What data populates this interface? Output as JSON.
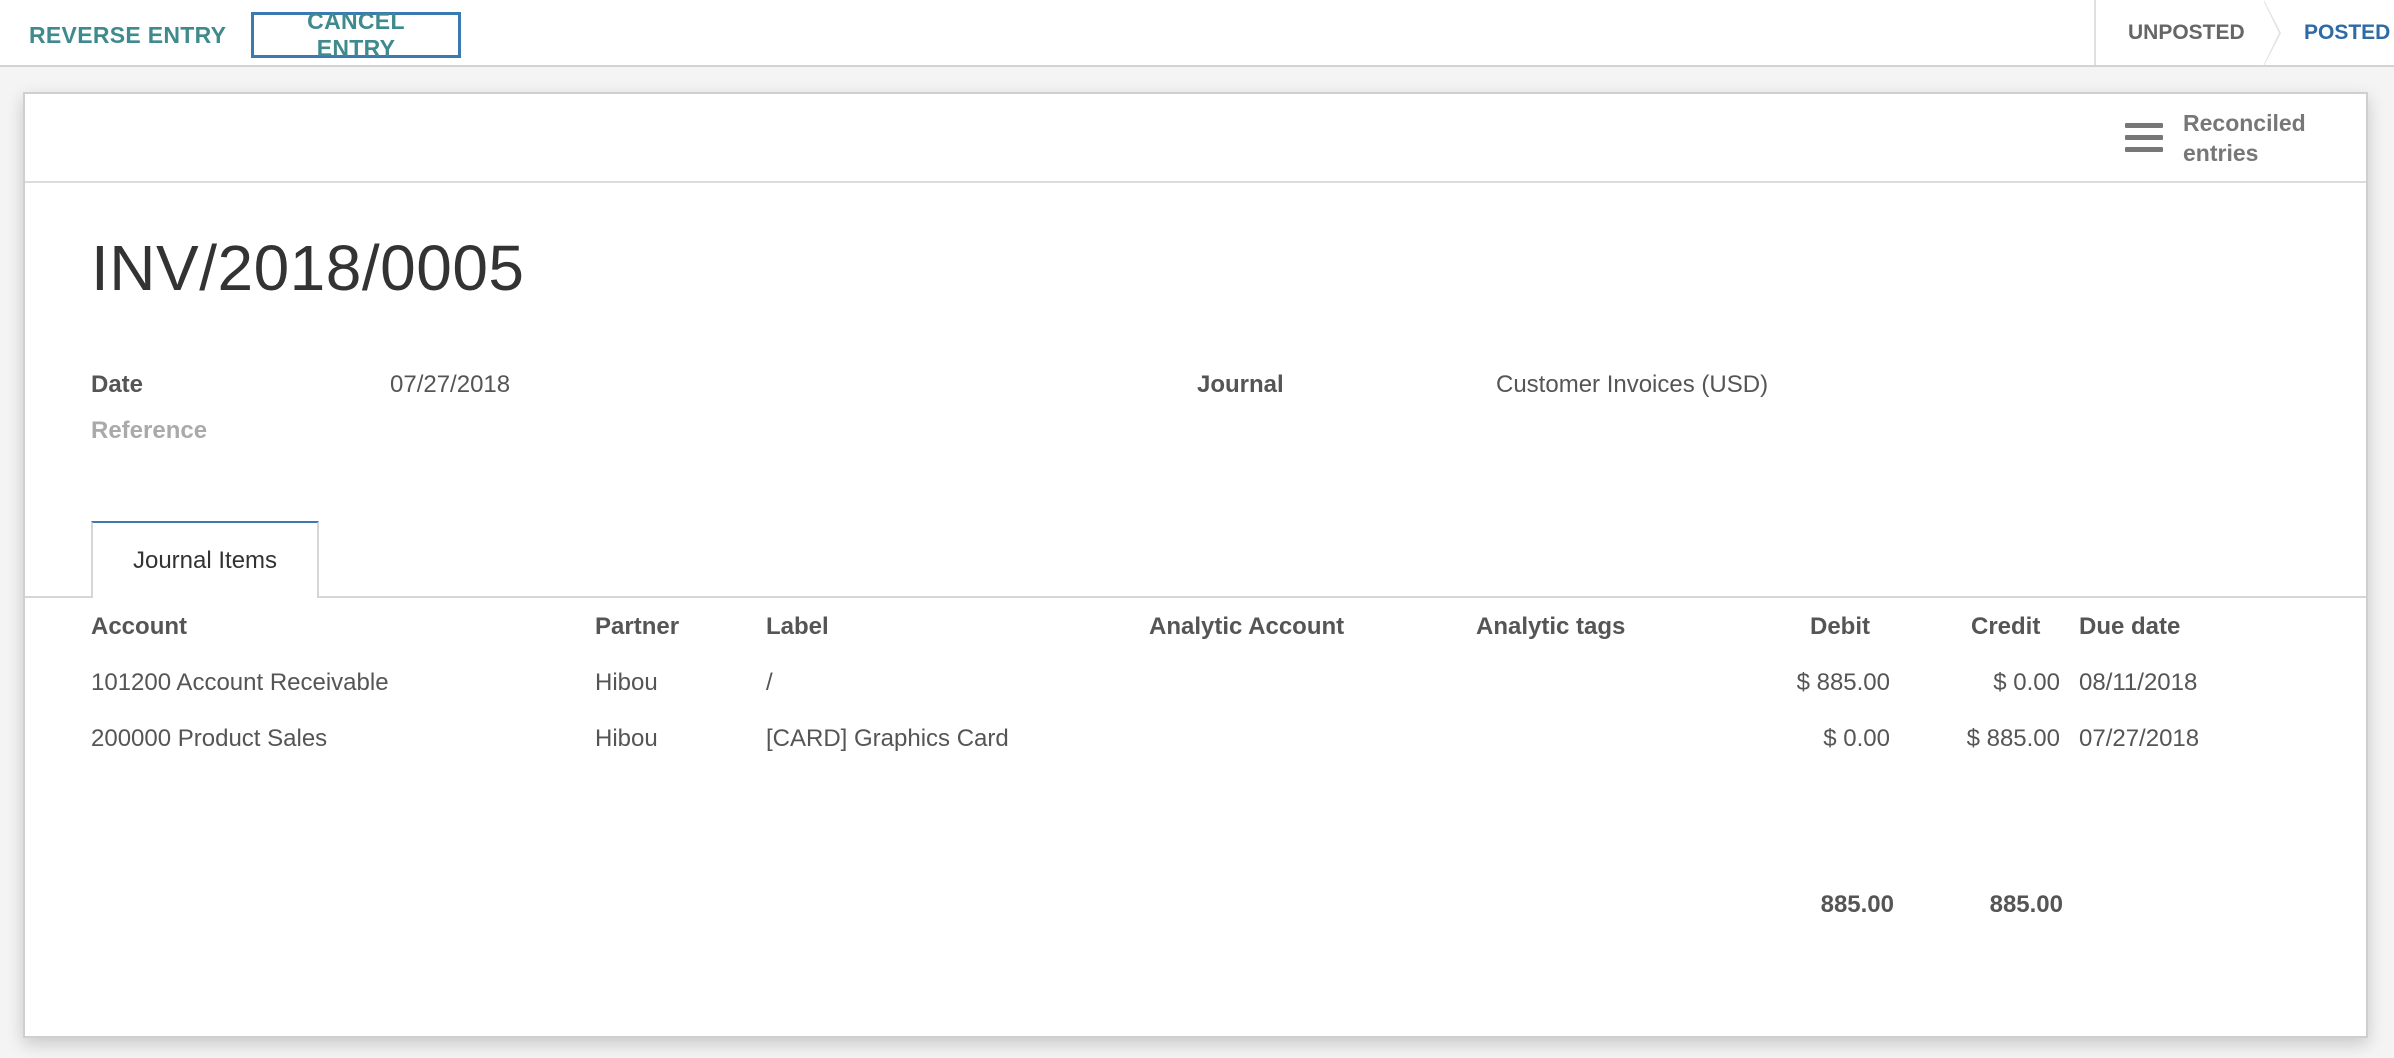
{
  "actions": {
    "reverse_label": "REVERSE ENTRY",
    "cancel_label": "CANCEL ENTRY"
  },
  "statusbar": {
    "stages": [
      "UNPOSTED",
      "POSTED"
    ],
    "current": "POSTED"
  },
  "smart_button": {
    "icon": "list-icon",
    "label_line1": "Reconciled",
    "label_line2": "entries"
  },
  "record": {
    "name": "INV/2018/0005",
    "date_label": "Date",
    "date": "07/27/2018",
    "reference_label": "Reference",
    "journal_label": "Journal",
    "journal": "Customer Invoices (USD)"
  },
  "notebook": {
    "tab": "Journal Items"
  },
  "table": {
    "columns": [
      "Account",
      "Partner",
      "Label",
      "Analytic Account",
      "Analytic tags",
      "Debit",
      "Credit",
      "Due date"
    ],
    "rows": [
      [
        "101200 Account Receivable",
        "Hibou",
        "/",
        "",
        "",
        "$ 885.00",
        "$ 0.00",
        "08/11/2018"
      ],
      [
        "200000 Product Sales",
        "Hibou",
        "[CARD] Graphics Card",
        "",
        "",
        "$ 0.00",
        "$ 885.00",
        "07/27/2018"
      ]
    ],
    "totals": {
      "debit": "885.00",
      "credit": "885.00"
    }
  },
  "colors": {
    "accent_teal": "#3e8a8c",
    "accent_blue": "#2e6aa6",
    "focus_border": "#3a7ab0"
  }
}
